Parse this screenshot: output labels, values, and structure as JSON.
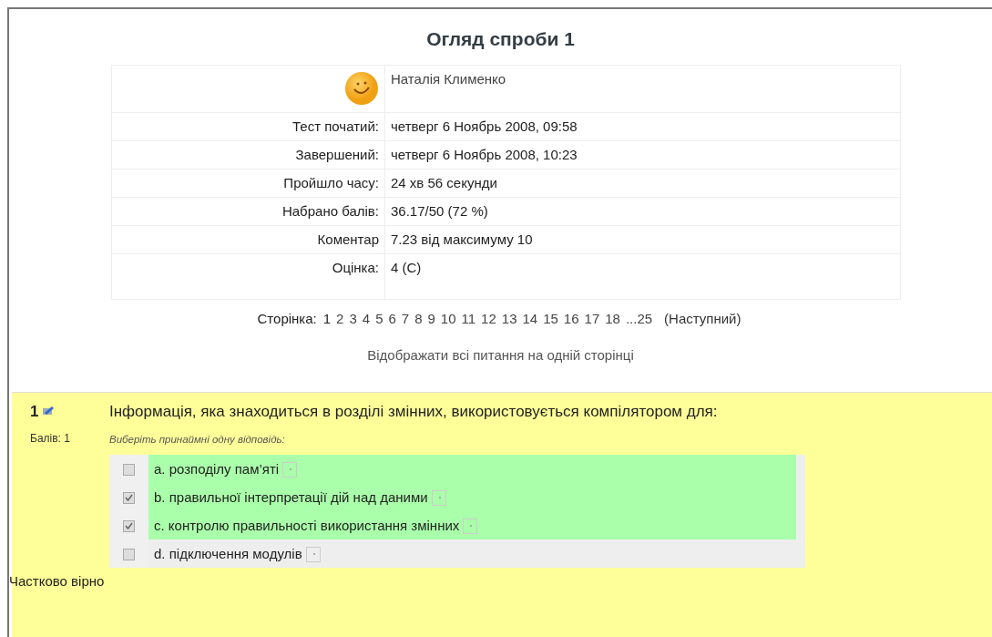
{
  "title": "Огляд спроби 1",
  "user": {
    "name": "Наталія Клименко"
  },
  "summary": [
    {
      "label": "Тест початий:",
      "value": "четверг 6 Ноябрь 2008, 09:58"
    },
    {
      "label": "Завершений:",
      "value": "четверг 6 Ноябрь 2008, 10:23"
    },
    {
      "label": "Пройшло часу:",
      "value": "24 хв 56 секунди"
    },
    {
      "label": "Набрано балів:",
      "value": "36.17/50 (72 %)"
    },
    {
      "label": "Коментар",
      "value": "7.23 від максимуму 10"
    },
    {
      "label": "Оцінка:",
      "value": "4 (C)"
    }
  ],
  "pagination": {
    "label": "Сторінка:",
    "pages": [
      {
        "label": "1",
        "selected": true
      },
      {
        "label": "2",
        "selected": false
      },
      {
        "label": "3",
        "selected": false
      },
      {
        "label": "4",
        "selected": false
      },
      {
        "label": "5",
        "selected": false
      },
      {
        "label": "6",
        "selected": false
      },
      {
        "label": "7",
        "selected": false
      },
      {
        "label": "8",
        "selected": false
      },
      {
        "label": "9",
        "selected": false
      },
      {
        "label": "10",
        "selected": false
      },
      {
        "label": "11",
        "selected": false
      },
      {
        "label": "12",
        "selected": false
      },
      {
        "label": "13",
        "selected": false
      },
      {
        "label": "14",
        "selected": false
      },
      {
        "label": "15",
        "selected": false
      },
      {
        "label": "16",
        "selected": false
      },
      {
        "label": "17",
        "selected": false
      },
      {
        "label": "18",
        "selected": false
      },
      {
        "label": "...25",
        "selected": false
      }
    ],
    "next": "(Наступний)"
  },
  "show_all_link": "Відображати всі питання на одній сторінці",
  "question": {
    "number": "1",
    "points": "Балів: 1",
    "text": "Інформація, яка знаходиться в розділі змінних, використовується компілятором для:",
    "hint": "Виберіть принаймні одну відповідь:",
    "options": [
      {
        "text": "a. розподілу пам’яті",
        "checked": false,
        "correct": true
      },
      {
        "text": "b. правильної інтерпретації дій над даними",
        "checked": true,
        "correct": true
      },
      {
        "text": "c. контролю правильності використання змінних",
        "checked": true,
        "correct": true
      },
      {
        "text": "d. підключення модулів",
        "checked": false,
        "correct": false
      }
    ],
    "result": "Частково вірно"
  }
}
